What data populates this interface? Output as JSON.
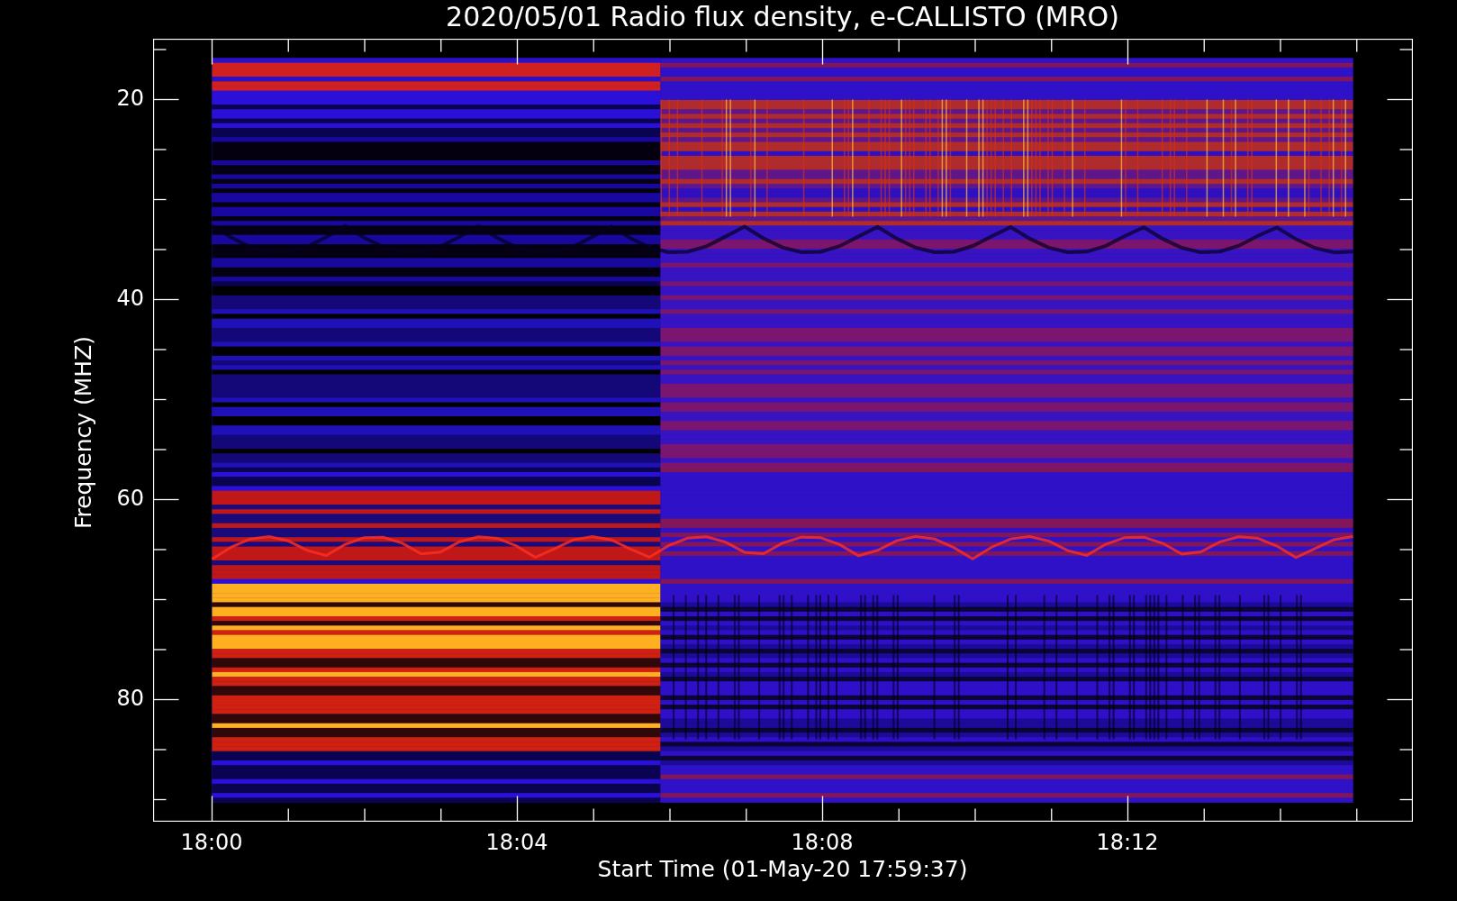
{
  "title": "2020/05/01  Radio flux density, e-CALLISTO (MRO)",
  "y_axis": {
    "label": "Frequency (MHZ)",
    "ticks": [
      "20",
      "40",
      "60",
      "80"
    ]
  },
  "x_axis": {
    "label": "Start Time (01-May-20 17:59:37)",
    "ticks": [
      "18:00",
      "18:04",
      "18:08",
      "18:12"
    ]
  }
}
